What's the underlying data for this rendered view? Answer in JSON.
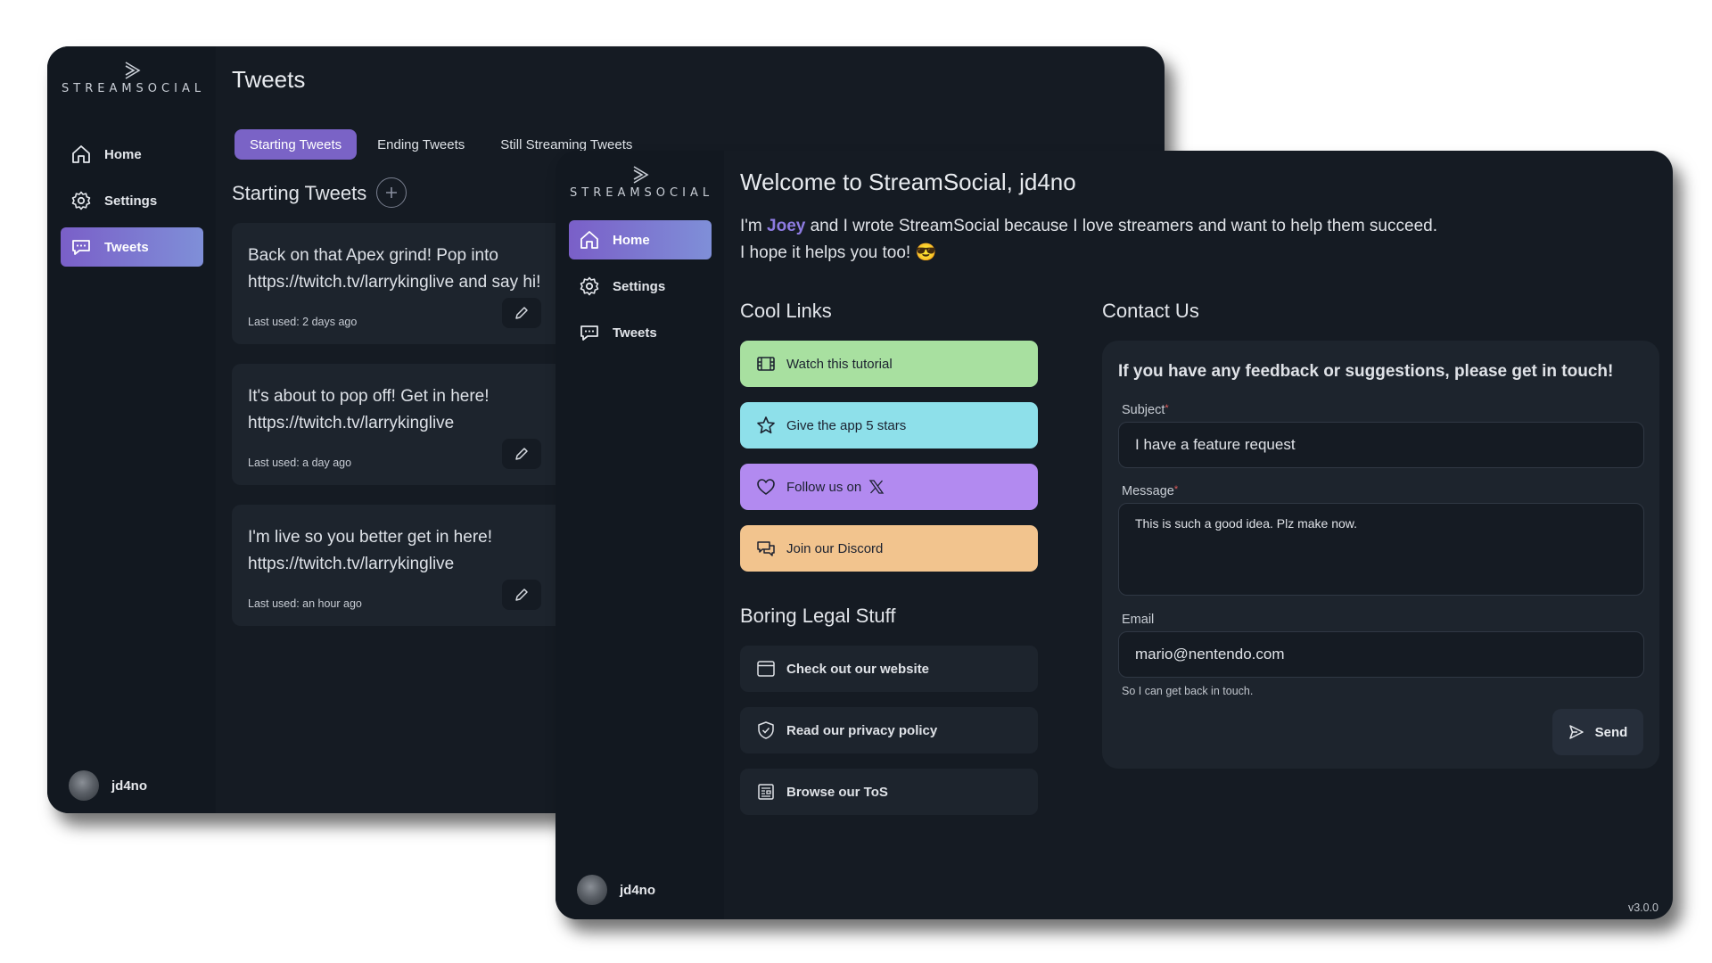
{
  "brand": {
    "logo_text": "STREAMSOCIAL"
  },
  "nav": {
    "home": "Home",
    "settings": "Settings",
    "tweets": "Tweets"
  },
  "user": {
    "name": "jd4no"
  },
  "back_window": {
    "page_title": "Tweets",
    "tabs": [
      "Starting Tweets",
      "Ending Tweets",
      "Still Streaming Tweets"
    ],
    "active_tab": "Starting Tweets",
    "section_title": "Starting Tweets",
    "tweets": [
      {
        "text": "Back on that Apex grind! Pop into\nhttps://twitch.tv/larrykinglive and say hi!",
        "last_used": "Last used: 2 days ago"
      },
      {
        "text": "It's about to pop off! Get in here!\nhttps://twitch.tv/larrykinglive",
        "last_used": "Last used: a day ago"
      },
      {
        "text": "I'm live so you better get in here!\nhttps://twitch.tv/larrykinglive",
        "last_used": "Last used: an hour ago"
      }
    ]
  },
  "front_window": {
    "welcome": "Welcome to StreamSocial, jd4no",
    "intro": {
      "prefix": "I'm ",
      "name": "Joey",
      "suffix": " and I wrote StreamSocial because I love streamers and want to help them succeed.",
      "line2": "I hope it helps you too! 😎"
    },
    "cool_links": {
      "title": "Cool Links",
      "items": [
        {
          "label": "Watch this tutorial",
          "icon": "film-icon",
          "color": "#a8e0a0"
        },
        {
          "label": "Give the app 5 stars",
          "icon": "star-icon",
          "color": "#8ee0ea"
        },
        {
          "label": "Follow us on",
          "icon": "heart-icon",
          "color": "#b28af0"
        },
        {
          "label": "Join our Discord",
          "icon": "chat-icon",
          "color": "#f2c48e"
        }
      ]
    },
    "legal": {
      "title": "Boring Legal Stuff",
      "items": [
        {
          "label": "Check out our website",
          "icon": "browser-icon"
        },
        {
          "label": "Read our privacy policy",
          "icon": "shield-check-icon"
        },
        {
          "label": "Browse our ToS",
          "icon": "document-icon"
        }
      ]
    },
    "contact": {
      "title": "Contact Us",
      "intro": "If you have any feedback or suggestions, please get in touch!",
      "subject_label": "Subject",
      "subject_value": "I have a feature request",
      "message_label": "Message",
      "message_value": "This is such a good idea. Plz make now.",
      "email_label": "Email",
      "email_value": "mario@nentendo.com",
      "email_help": "So I can get back in touch.",
      "send_label": "Send"
    },
    "version": "v3.0.0"
  },
  "colors": {
    "window_bg": "#151b23",
    "sidebar_bg": "#121820",
    "card_bg": "#1d242d",
    "accent": "#7a63c6"
  }
}
